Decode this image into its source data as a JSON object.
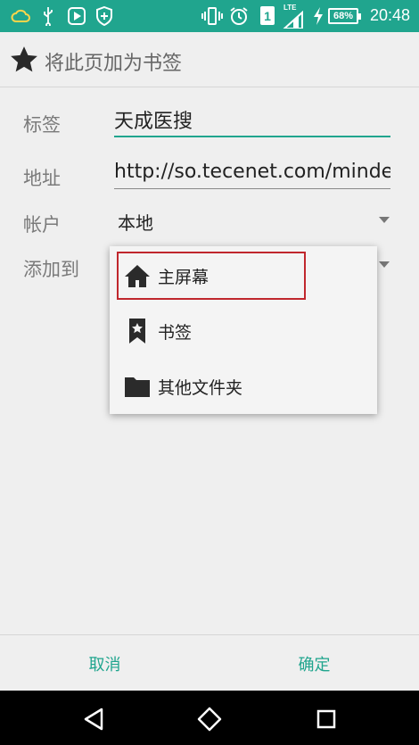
{
  "status_bar": {
    "icons": [
      "cloud-icon",
      "usb-icon",
      "play-store-icon",
      "shield-icon",
      "vibrate-icon",
      "alarm-icon",
      "sim-icon",
      "signal-icon",
      "charging-icon"
    ],
    "sim_label": "1",
    "network_label": "LTE",
    "battery_text": "68%",
    "time": "20:48",
    "color": "#20a58e"
  },
  "header": {
    "title": "将此页加为书签",
    "icon": "star-icon"
  },
  "form": {
    "label_field": {
      "label": "标签",
      "value": "天成医搜"
    },
    "address_field": {
      "label": "地址",
      "value": "http://so.tecenet.com/mindex"
    },
    "account_field": {
      "label": "帐户",
      "value": "本地"
    },
    "add_to_field": {
      "label": "添加到"
    }
  },
  "dropdown": {
    "items": [
      {
        "label": "主屏幕",
        "icon": "home-icon",
        "highlighted": true
      },
      {
        "label": "书签",
        "icon": "bookmark-star-icon"
      },
      {
        "label": "其他文件夹",
        "icon": "folder-icon"
      }
    ],
    "highlight_color": "#c0272d"
  },
  "buttons": {
    "cancel": "取消",
    "confirm": "确定",
    "accent": "#20a58e"
  },
  "navbar": {
    "icons": [
      "back-icon",
      "home-nav-icon",
      "recents-icon"
    ]
  }
}
